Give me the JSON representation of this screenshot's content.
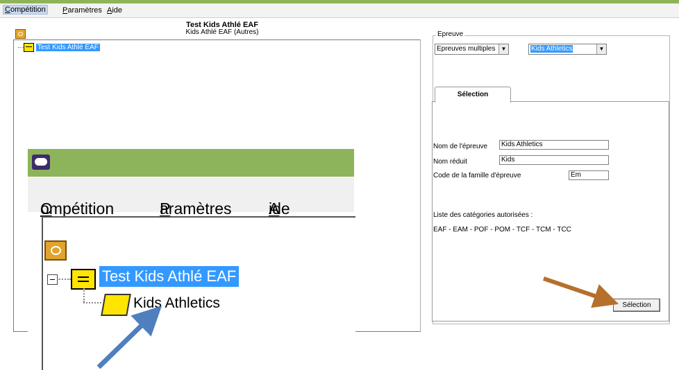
{
  "menubar": {
    "items": [
      {
        "label": "Compétition",
        "key": "C",
        "rest": "ompétition"
      },
      {
        "label": "Paramètres",
        "key": "P",
        "rest": "aramètres"
      },
      {
        "label": "Aide",
        "key": "A",
        "rest": "ide"
      }
    ]
  },
  "header": {
    "title": "Test Kids Athlé EAF",
    "subtitle": "Kids Athlé EAF (Autres)"
  },
  "tree": {
    "root_label": "Test Kids Athlé EAF",
    "child_label": "Kids Athletics"
  },
  "epreuve": {
    "legend": "Epreuve",
    "combo_type": "Epreuves multiples",
    "combo_event": "Kids Athletics",
    "tab_label": "Sélection",
    "fields": {
      "nom_label": "Nom de l'épreuve",
      "nom_value": "Kids Athletics",
      "reduit_label": "Nom réduit",
      "reduit_value": "Kids",
      "code_label": "Code de  la famille d'épreuve",
      "code_value": "Em"
    },
    "categories_label": "Liste des catégories autorisées :",
    "categories_value": "EAF - EAM - POF - POM - TCF - TCM - TCC",
    "button_label": "Sélection"
  },
  "colors": {
    "accent_green": "#8db45a",
    "selection_blue": "#3399ff",
    "arrow_orange": "#b5702c",
    "arrow_blue": "#4f7fbf"
  }
}
